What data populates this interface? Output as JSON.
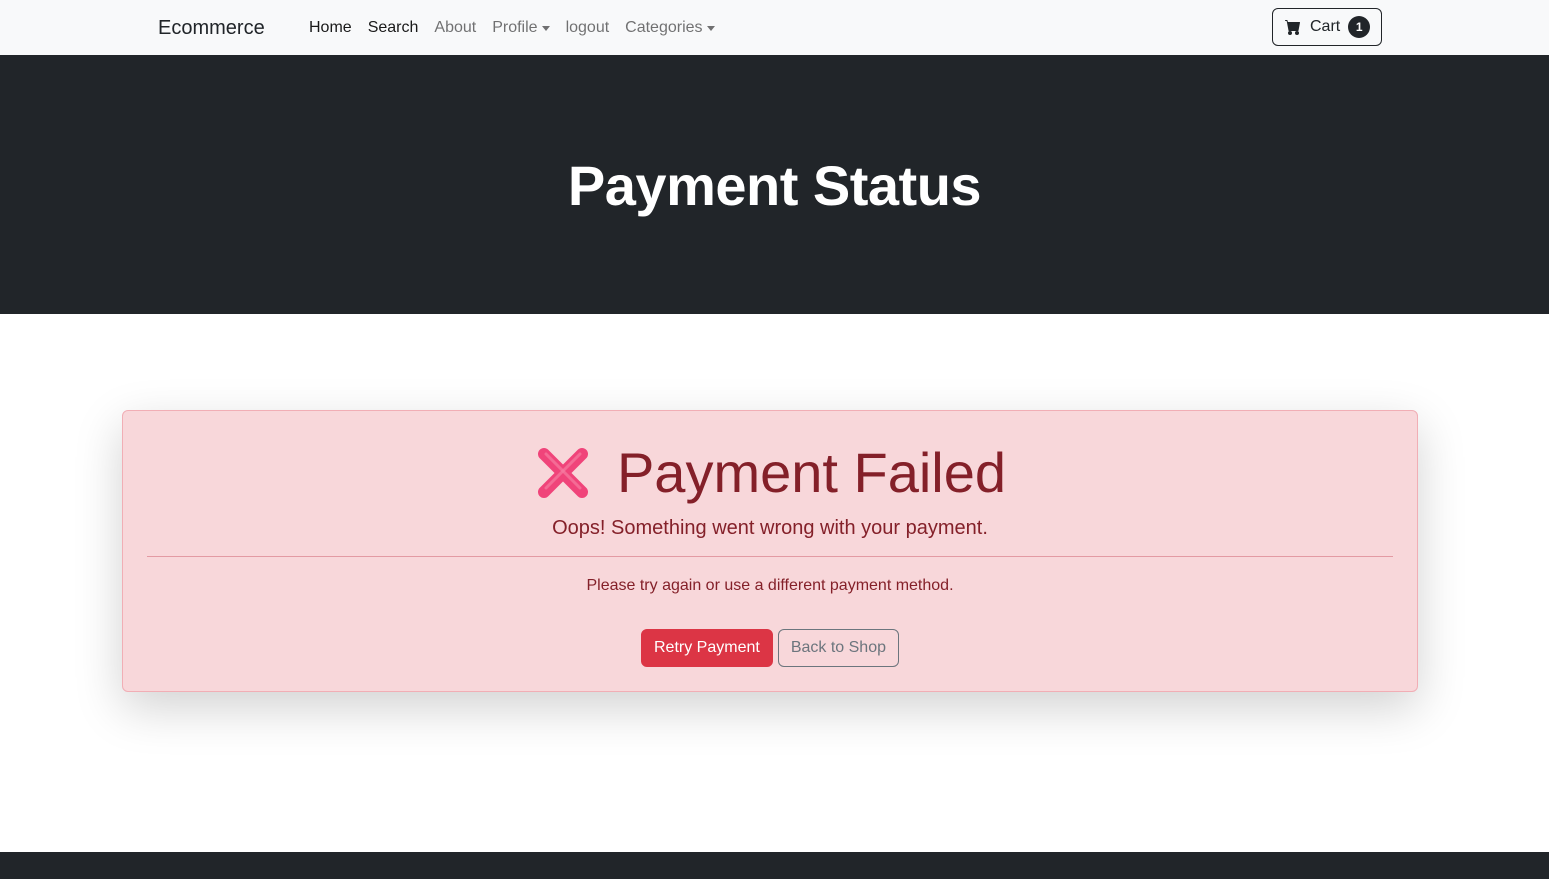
{
  "navbar": {
    "brand": "Ecommerce",
    "links": [
      {
        "label": "Home"
      },
      {
        "label": "Search"
      },
      {
        "label": "About"
      },
      {
        "label": "Profile"
      },
      {
        "label": "logout"
      },
      {
        "label": "Categories"
      }
    ],
    "cart": {
      "label": "Cart",
      "count": "1",
      "icon": "cart-icon"
    }
  },
  "hero": {
    "title": "Payment Status"
  },
  "alert": {
    "icon": "cross-mark-icon",
    "heading": "Payment Failed",
    "lead": "Oops! Something went wrong with your payment.",
    "text": "Please try again or use a different payment method.",
    "retry_label": "Retry Payment",
    "back_label": "Back to Shop"
  },
  "colors": {
    "navbar_bg": "#f8f9fa",
    "hero_bg": "#212529",
    "alert_bg": "#f8d7da",
    "alert_text": "#842029",
    "danger": "#dc3545",
    "secondary": "#6c757d",
    "icon_pink": "#f0447a"
  }
}
